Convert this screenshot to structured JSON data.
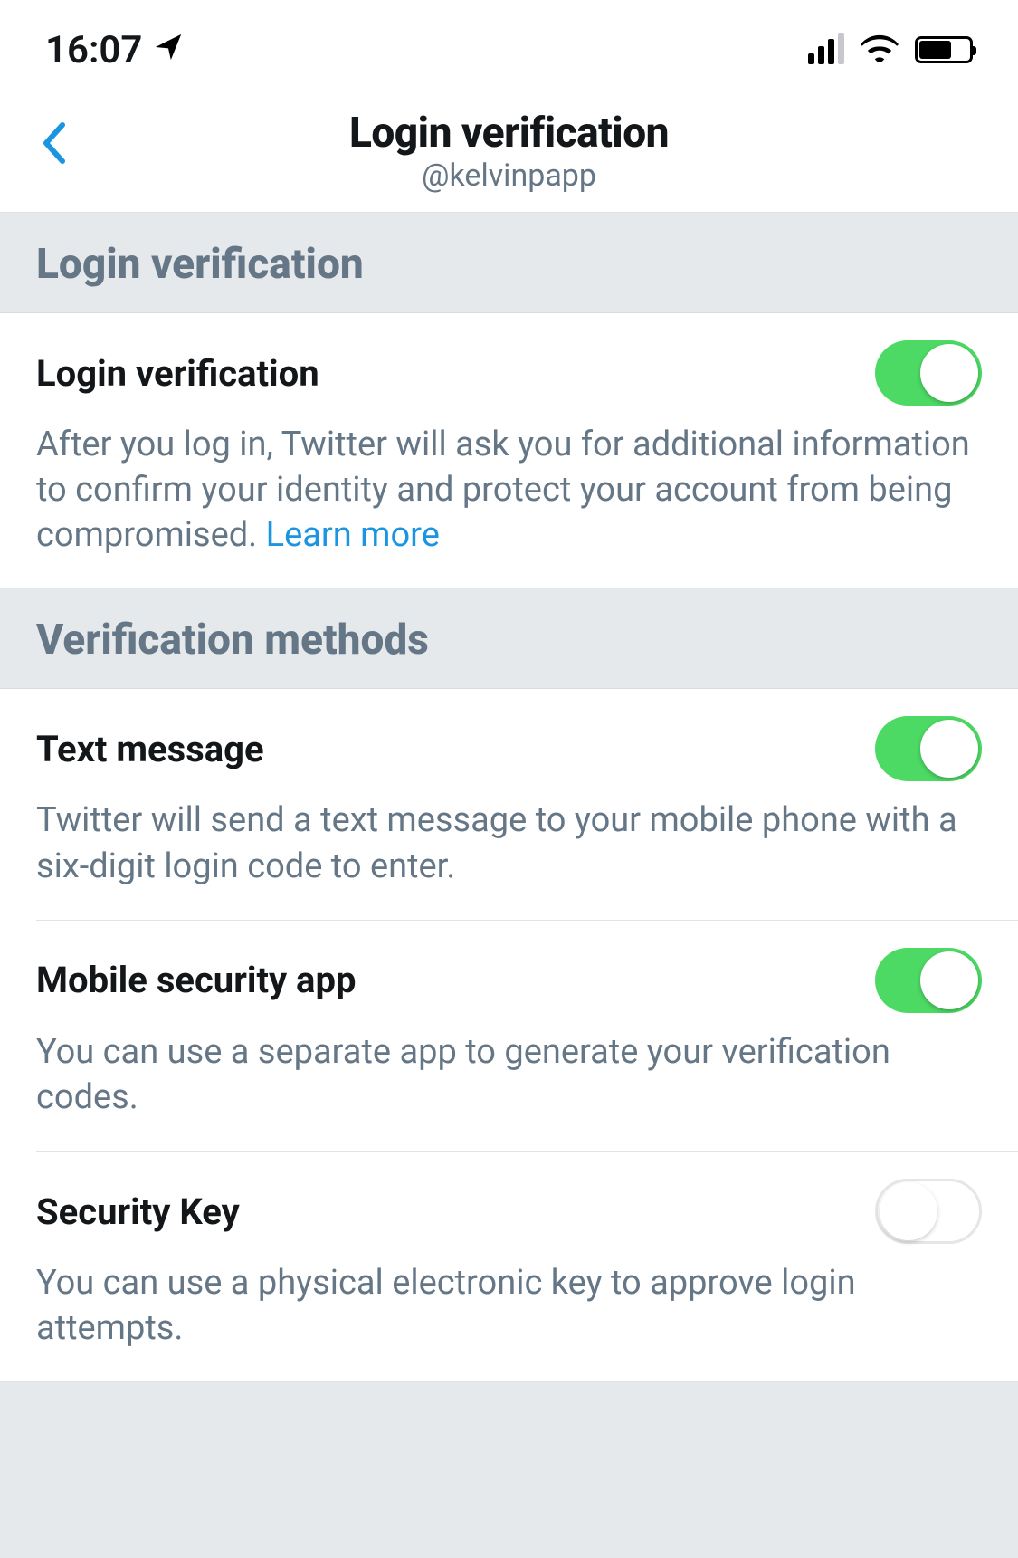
{
  "status_bar": {
    "time": "16:07"
  },
  "header": {
    "title": "Login verification",
    "subtitle": "@kelvinpapp"
  },
  "section1": {
    "header": "Login verification",
    "item": {
      "title": "Login verification",
      "description": "After you log in, Twitter will ask you for additional information to confirm your identity and protect your account from being compromised. ",
      "learn_more": "Learn more",
      "enabled": true
    }
  },
  "section2": {
    "header": "Verification methods",
    "items": [
      {
        "title": "Text message",
        "description": "Twitter will send a text message to your mobile phone with a six-digit login code to enter.",
        "enabled": true
      },
      {
        "title": "Mobile security app",
        "description": "You can use a separate app to generate your verification codes.",
        "enabled": true
      },
      {
        "title": "Security Key",
        "description": "You can use a physical electronic key to approve login attempts.",
        "enabled": false
      }
    ]
  }
}
